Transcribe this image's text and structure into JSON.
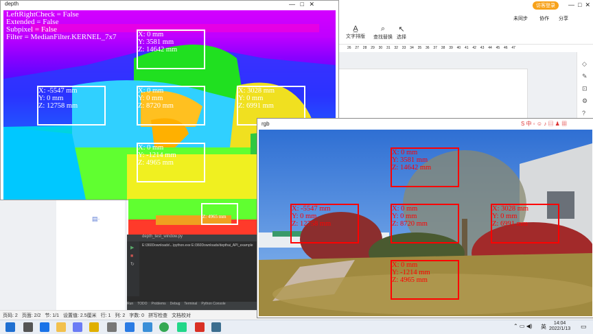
{
  "depth_window": {
    "title": "depth",
    "params": [
      "LeftRightCheck = False",
      "Extended = False",
      "Subpixel = False",
      "Filter = MedianFilter.KERNEL_7x7"
    ],
    "boxes": [
      {
        "lines": [
          "X: 0 mm",
          "Y: 3581 mm",
          "Z: 14642 mm"
        ]
      },
      {
        "lines": [
          "X: -5547 mm",
          "Y: 0 mm",
          "Z: 12758 mm"
        ]
      },
      {
        "lines": [
          "X: 0 mm",
          "Y: 0 mm",
          "Z: 8720 mm"
        ]
      },
      {
        "lines": [
          "X: 3028 mm",
          "Y: 0 mm",
          "Z: 6991 mm"
        ]
      },
      {
        "lines": [
          "X: 0 mm",
          "Y: -1214 mm",
          "Z: 4965 mm"
        ]
      }
    ],
    "hidden_box_text": "Z: 4965 mm"
  },
  "rgb_window": {
    "title": "rgb",
    "boxes": [
      {
        "lines": [
          "X: 0 mm",
          "Y: 3581 mm",
          "Z: 14642 mm"
        ]
      },
      {
        "lines": [
          "X: -5547 mm",
          "Y: 0 mm",
          "Z: 12758 mm"
        ]
      },
      {
        "lines": [
          "X: 0 mm",
          "Y: 0 mm",
          "Z: 8720 mm"
        ]
      },
      {
        "lines": [
          "X: 3028 mm",
          "Y: 0 mm",
          "Z: 6991 mm"
        ]
      },
      {
        "lines": [
          "X: 0 mm",
          "Y: -1214 mm",
          "Z: 4965 mm"
        ]
      }
    ]
  },
  "word": {
    "login_label": "访客登录",
    "title_actions": [
      "未同步",
      "协作",
      "分享"
    ],
    "ribbon": [
      "文字排版",
      "查找替换",
      "选择"
    ],
    "ruler_numbers": [
      "26",
      "27",
      "28",
      "29",
      "30",
      "31",
      "32",
      "33",
      "34",
      "35",
      "36",
      "37",
      "38",
      "39",
      "40",
      "41",
      "42",
      "43",
      "44",
      "45",
      "46",
      "47"
    ]
  },
  "statusbar": {
    "items": [
      "页码: 2",
      "页面: 2/2",
      "节: 1/1",
      "设置值: 2.5厘米",
      "行: 1",
      "列: 2",
      "字数: 0",
      "拼写检查",
      "文档校对"
    ]
  },
  "ide": {
    "tab": "depth_test_window.py",
    "console_line": "E:\\360Downloads\\...\\python.exe E:/360Downloads/depthai_API_example",
    "bottom_tabs": [
      "Run",
      "TODO",
      "Problems",
      "Debug",
      "Terminal",
      "Python Console"
    ]
  },
  "taskbar": {
    "time": "14:04",
    "date": "2022/1/13",
    "lang": "英"
  },
  "colors": {
    "box_depth": "#ffffff",
    "text_depth": "#ffffff",
    "box_rgb": "#ff0000",
    "text_rgb": "#ff0000",
    "accent": "#f7a21b"
  }
}
